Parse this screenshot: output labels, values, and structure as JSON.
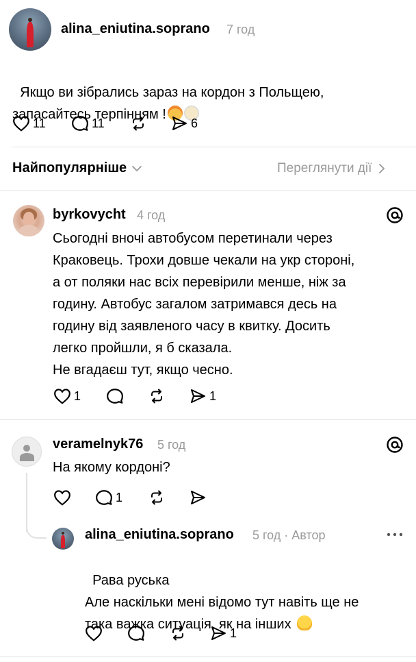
{
  "post": {
    "username": "alina_eniutina.soprano",
    "time": "7 год",
    "text": "Якщо ви зібрались зараз на кордон з Польщею,\nзапасайтесь терпінням !",
    "likes": "11",
    "replies": "11",
    "shares": "6"
  },
  "sort_bar": {
    "label": "Найпопулярніше",
    "activity_label": "Переглянути дії"
  },
  "comments": [
    {
      "username": "byrkovycht",
      "time": "4 год",
      "text": "Сьогодні вночі автобусом перетинали через\nКраковець. Трохи довше чекали на укр стороні,\nа от поляки нас всіх перевірили менше, ніж за\nгодину. Автобус загалом затримався десь на\nгодину від заявленого часу в квитку. Досить\nлегко пройшли, я б сказала.\nНе вгадаєш тут, якщо чесно.",
      "likes": "1",
      "shares": "1"
    },
    {
      "username": "veramelnyk76",
      "time": "5 год",
      "text": "На якому кордоні?",
      "replies": "1"
    },
    {
      "username": "alina_eniutina.soprano",
      "time": "5 год · Автор",
      "text": "Рава руська\nАле наскільки мені відомо тут навіть ще не\nтака важка ситуація, як на інших",
      "shares": "1"
    }
  ],
  "icons": [
    "heart-icon",
    "comment-icon",
    "repost-icon",
    "send-icon",
    "threads-logo-icon",
    "chevron-down-icon",
    "chevron-right-icon",
    "more-icon",
    "exploding-head-emoji",
    "face-exhaling-emoji",
    "melting-face-emoji"
  ]
}
